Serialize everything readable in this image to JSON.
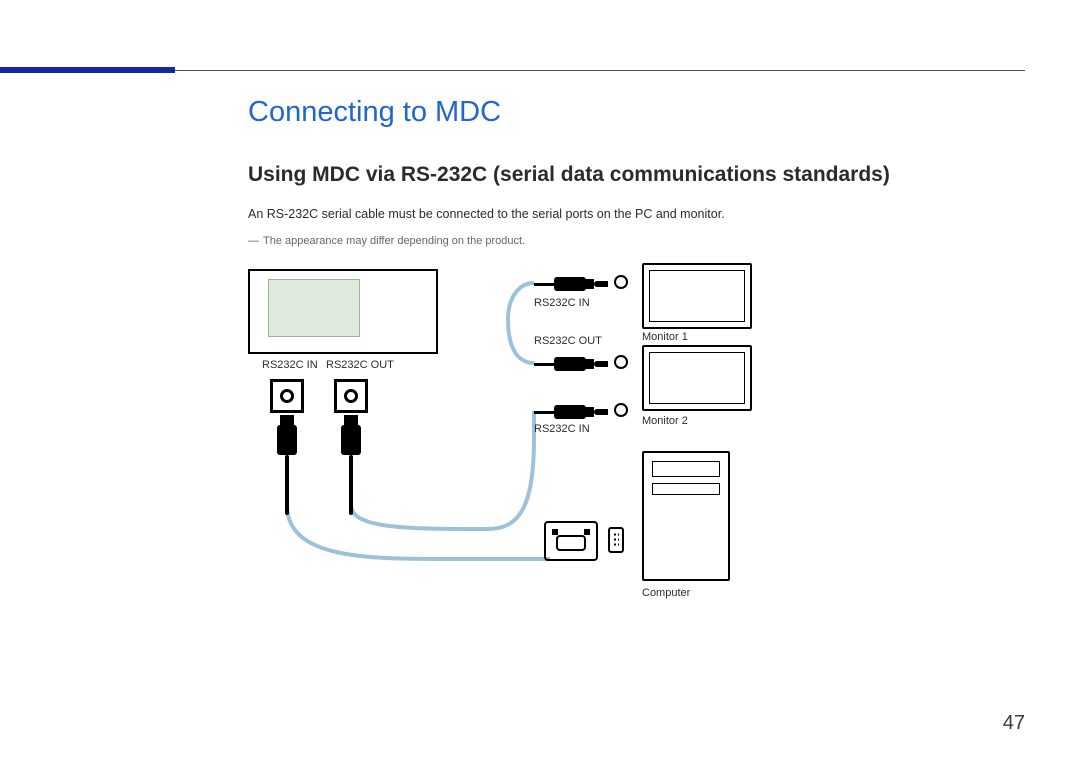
{
  "page": {
    "number": "47",
    "title": "Connecting to MDC",
    "subtitle": "Using MDC via RS-232C (serial data communications standards)",
    "body": "An RS-232C serial cable must be connected to the serial ports on the PC and monitor.",
    "note": "The appearance may differ depending on the product."
  },
  "diagram": {
    "port_in_label": "RS232C IN",
    "port_out_label": "RS232C OUT",
    "side_rs232c_in": "RS232C IN",
    "side_rs232c_out": "RS232C OUT",
    "side_rs232c_in_2": "RS232C IN",
    "monitor1_label": "Monitor 1",
    "monitor2_label": "Monitor 2",
    "computer_label": "Computer"
  },
  "colors": {
    "accent": "#1428A0",
    "heading": "#1e66d0"
  }
}
